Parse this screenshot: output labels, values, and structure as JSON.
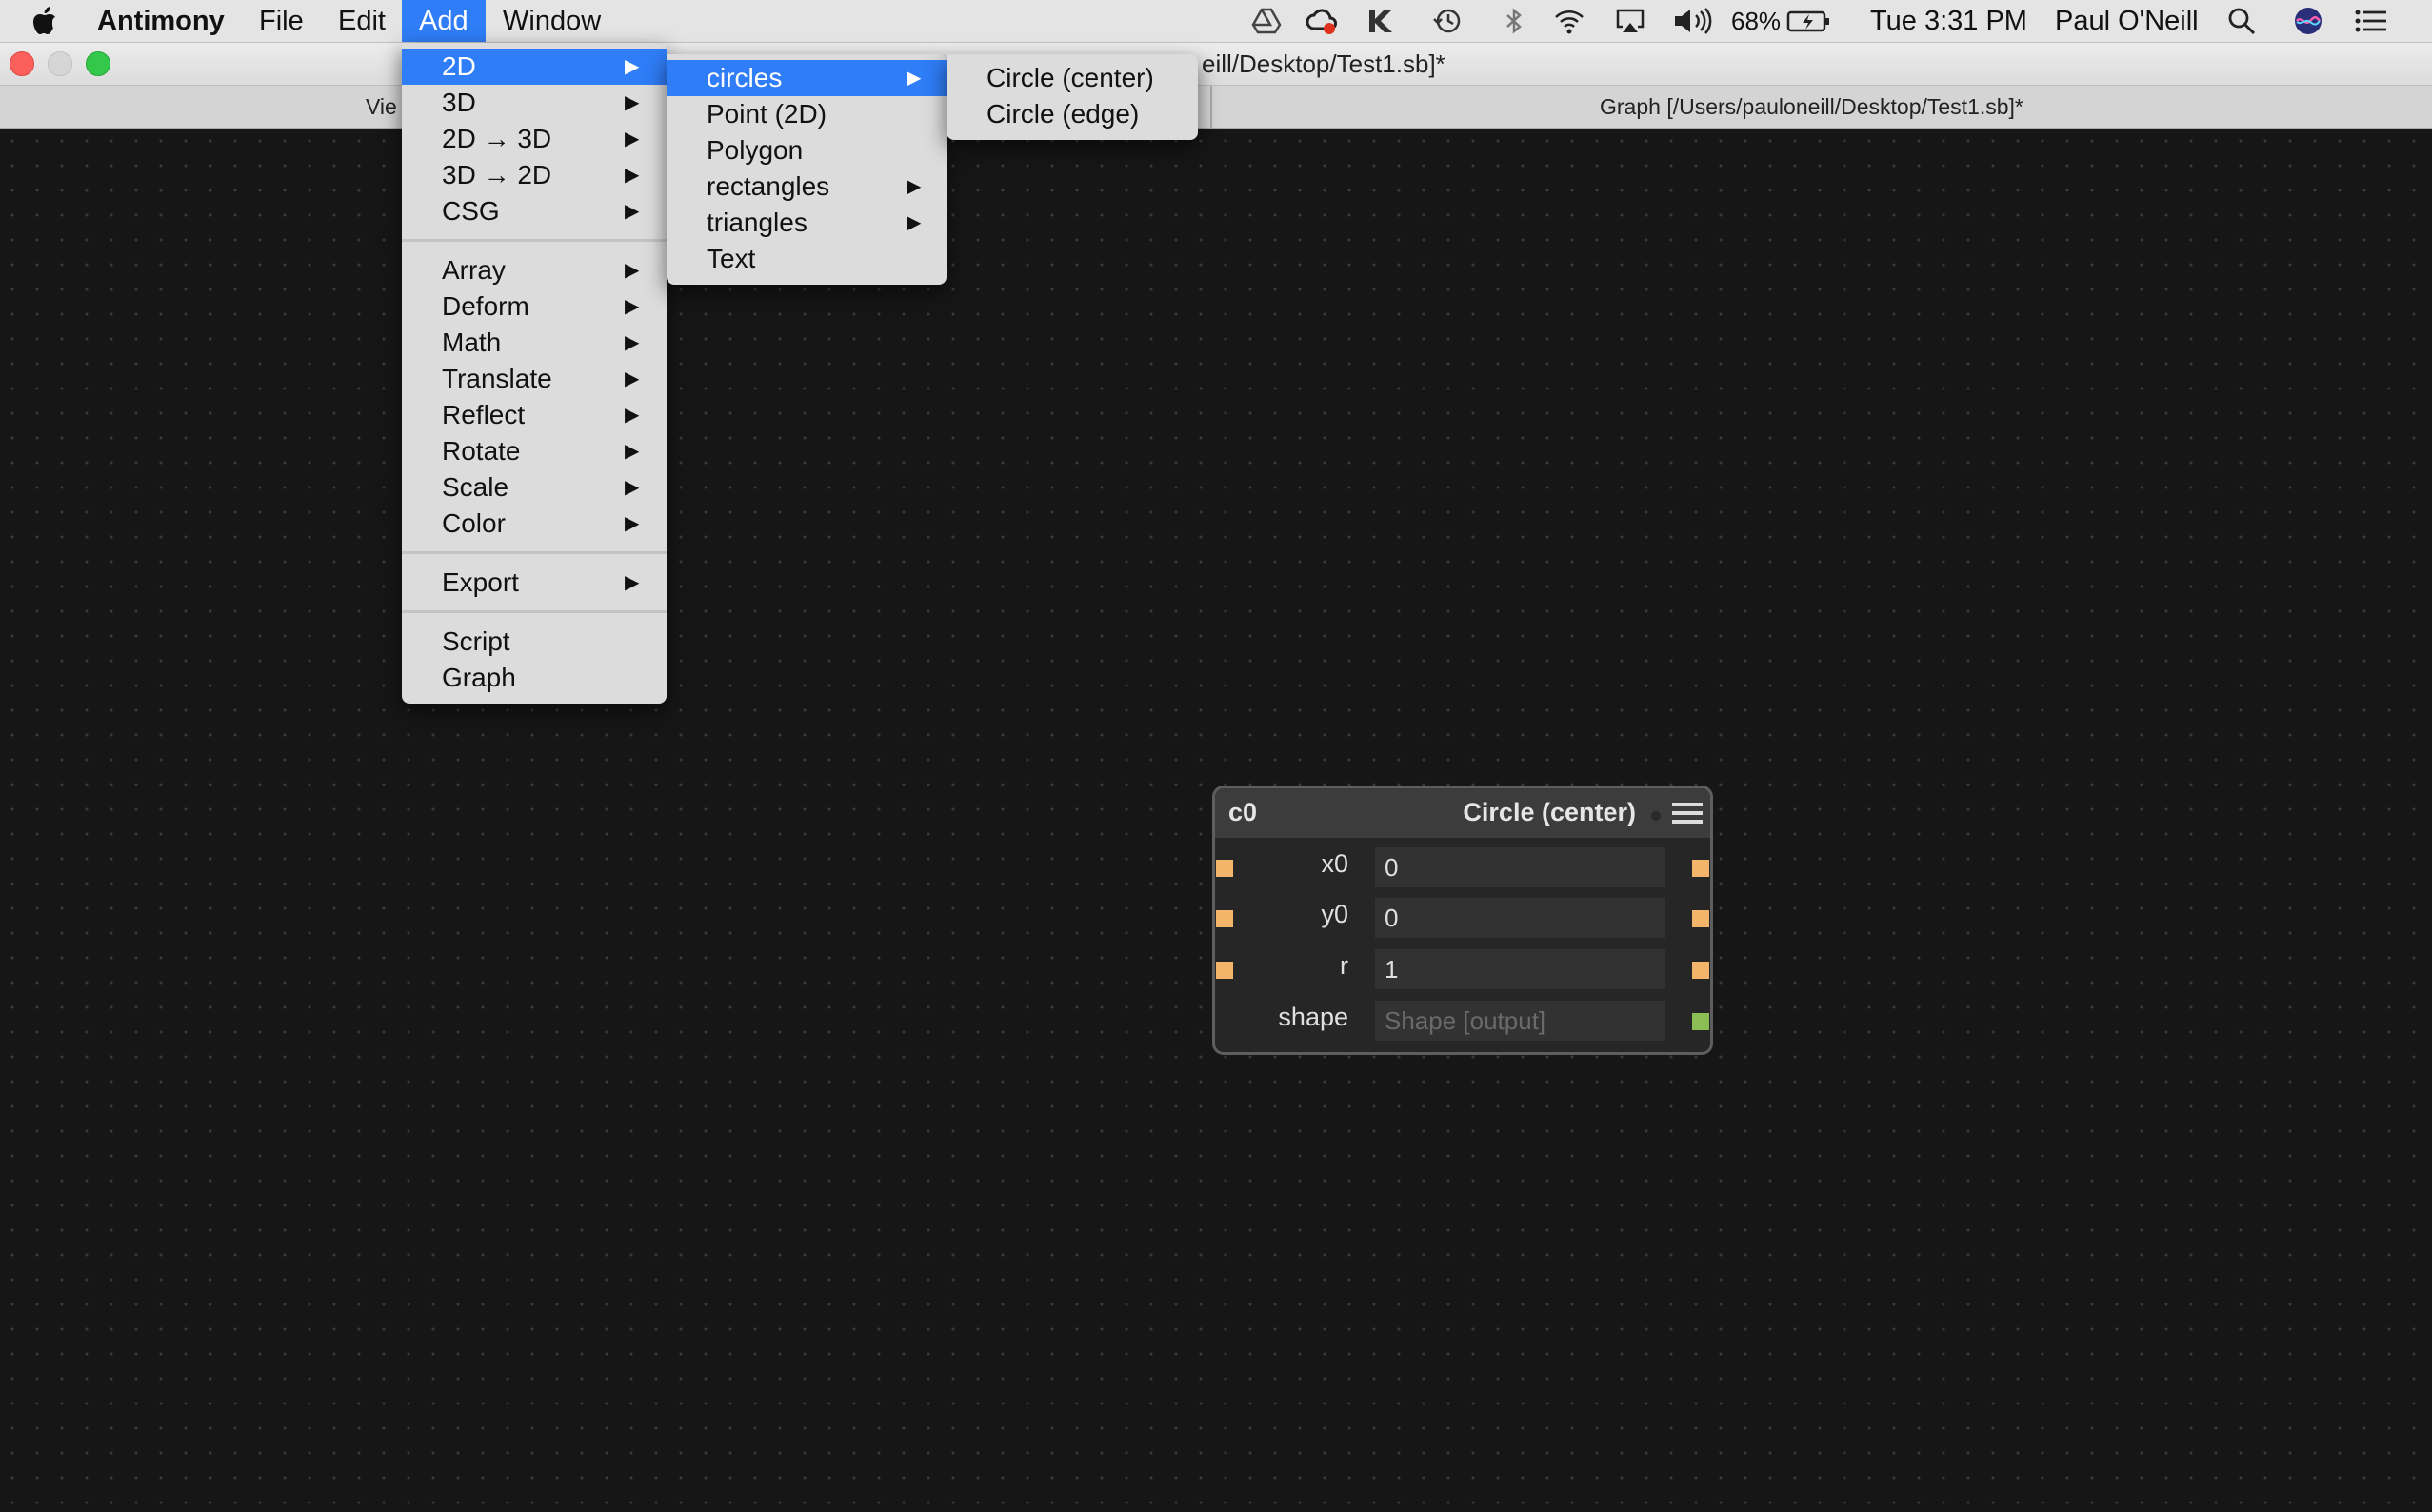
{
  "menubar": {
    "app_name": "Antimony",
    "menus": [
      "File",
      "Edit",
      "Add",
      "Window"
    ],
    "active_menu": "Add",
    "battery_percent": "68%",
    "clock": "Tue 3:31 PM",
    "user": "Paul O'Neill",
    "tray_icons": [
      "google-drive-icon",
      "creative-cloud-icon",
      "keyboard-maestro-icon",
      "time-machine-icon",
      "bluetooth-icon",
      "wifi-icon",
      "airplay-icon",
      "volume-icon",
      "battery-icon",
      "spotlight-icon",
      "siri-icon",
      "notification-center-icon"
    ]
  },
  "window": {
    "title_fragment": "eill/Desktop/Test1.sb]*",
    "tab_view_fragment": "Vie",
    "tab_graph": "Graph [/Users/pauloneill/Desktop/Test1.sb]*"
  },
  "menus": {
    "add": {
      "group1": [
        "2D",
        "3D",
        "2D → 3D",
        "3D → 2D",
        "CSG"
      ],
      "group2": [
        "Array",
        "Deform",
        "Math",
        "Translate",
        "Reflect",
        "Rotate",
        "Scale",
        "Color"
      ],
      "group3": [
        "Export"
      ],
      "group4": [
        "Script",
        "Graph"
      ],
      "highlighted": "2D"
    },
    "two_d": {
      "items": [
        "circles",
        "Point (2D)",
        "Polygon",
        "rectangles",
        "triangles",
        "Text"
      ],
      "highlighted": "circles"
    },
    "circles": {
      "items": [
        "Circle (center)",
        "Circle (edge)"
      ]
    }
  },
  "node": {
    "name": "c0",
    "type": "Circle (center)",
    "rows": [
      {
        "label": "x0",
        "value": "0"
      },
      {
        "label": "y0",
        "value": "0"
      },
      {
        "label": "r",
        "value": "1"
      },
      {
        "label": "shape",
        "placeholder": "Shape [output]"
      }
    ]
  },
  "colors": {
    "accent": "#2f7df7",
    "canvas": "#161616",
    "port_float": "#f2b56a",
    "port_shape": "#8bbf56"
  }
}
